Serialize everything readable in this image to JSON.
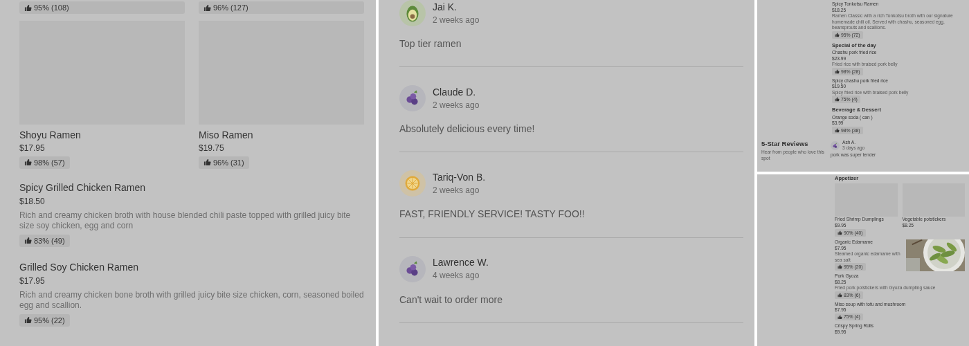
{
  "menu_panel": {
    "top_ratings": [
      "95% (108)",
      "96% (127)"
    ],
    "grid_items": [
      {
        "name": "Shoyu Ramen",
        "price": "$17.95",
        "rating": "98% (57)"
      },
      {
        "name": "Miso Ramen",
        "price": "$19.75",
        "rating": "96% (31)"
      }
    ],
    "list_items": [
      {
        "name": "Spicy Grilled Chicken Ramen",
        "price": "$18.50",
        "description": "Rich and creamy chicken broth with house blended chili paste topped with grilled juicy bite size soy chicken, egg and corn",
        "rating": "83% (49)"
      },
      {
        "name": "Grilled Soy Chicken Ramen",
        "price": "$17.95",
        "description": "Rich and creamy chicken bone broth with grilled juicy bite size chicken, corn, seasoned boiled egg and scallion.",
        "rating": "95% (22)"
      }
    ]
  },
  "reviews_panel": {
    "reviews": [
      {
        "name": "Jai K.",
        "time": "2 weeks ago",
        "text": "Top tier ramen",
        "avatar": {
          "kind": "avocado"
        }
      },
      {
        "name": "Claude D.",
        "time": "2 weeks ago",
        "text": "Absolutely delicious every time!",
        "avatar": {
          "kind": "berries"
        }
      },
      {
        "name": "Tariq-Von B.",
        "time": "2 weeks ago",
        "text": "FAST, FRIENDLY SERVICE! TASTY FOO!!",
        "avatar": {
          "kind": "lemon"
        }
      },
      {
        "name": "Lawrence W.",
        "time": "4 weeks ago",
        "text": "Can't wait to order more",
        "avatar": {
          "kind": "berries"
        }
      }
    ]
  },
  "menu_preview_top": {
    "first_item": {
      "name": "Spicy Tonkotsu Ramen",
      "price": "$18.25",
      "description": "Ramen Classic with a rich Tonkotsu broth with our signature homemade chili oil. Served with chashu, seasoned egg, beansprouts and scallions.",
      "rating": "95% (72)"
    },
    "sections": [
      {
        "title": "Special of the day",
        "items": [
          {
            "name": "Chashu pork fried rice",
            "price": "$23.99",
            "description": "Fried rice with braised pork belly",
            "rating": "98% (28)"
          },
          {
            "name": "Spicy chashu pork fried rice",
            "price": "$19.50",
            "description": "Spicy fried rice with braised pork belly",
            "rating": "75% (4)"
          }
        ]
      },
      {
        "title": "Beverage & Dessert",
        "items": [
          {
            "name": "Orange soda ( can )",
            "price": "$3.99",
            "rating": "98% (38)"
          }
        ]
      }
    ],
    "reviews": {
      "title": "5-Star Reviews",
      "subtitle": "Hear from people who love this spot",
      "review": {
        "name": "Ash A.",
        "time": "3 days ago",
        "text": "pork was super tender",
        "avatar": {
          "kind": "berries"
        }
      }
    }
  },
  "menu_preview_bottom": {
    "section_title": "Appetizer",
    "grid_items": [
      {
        "name": "Fried Shrimp Dumplings",
        "price": "$9.95",
        "rating": "90% (40)"
      },
      {
        "name": "Vegetable potstickers",
        "price": "$8.25"
      }
    ],
    "items": [
      {
        "name": "Organic Edamame",
        "price": "$7.95",
        "description": "Steamed organic edamame with sea salt",
        "rating": "95% (20)",
        "photo": true
      },
      {
        "name": "Pork Gyoza",
        "price": "$8.25",
        "description": "Fried pork potstickers with Gyoza dumpling sauce",
        "rating": "83% (6)",
        "photo": false
      },
      {
        "name": "Miso soup with tofu and mushroom",
        "price": "$7.95",
        "rating": "75% (4)",
        "photo": false
      },
      {
        "name": "Crispy Spring Rolls",
        "price": "$9.95",
        "photo": false
      }
    ]
  }
}
